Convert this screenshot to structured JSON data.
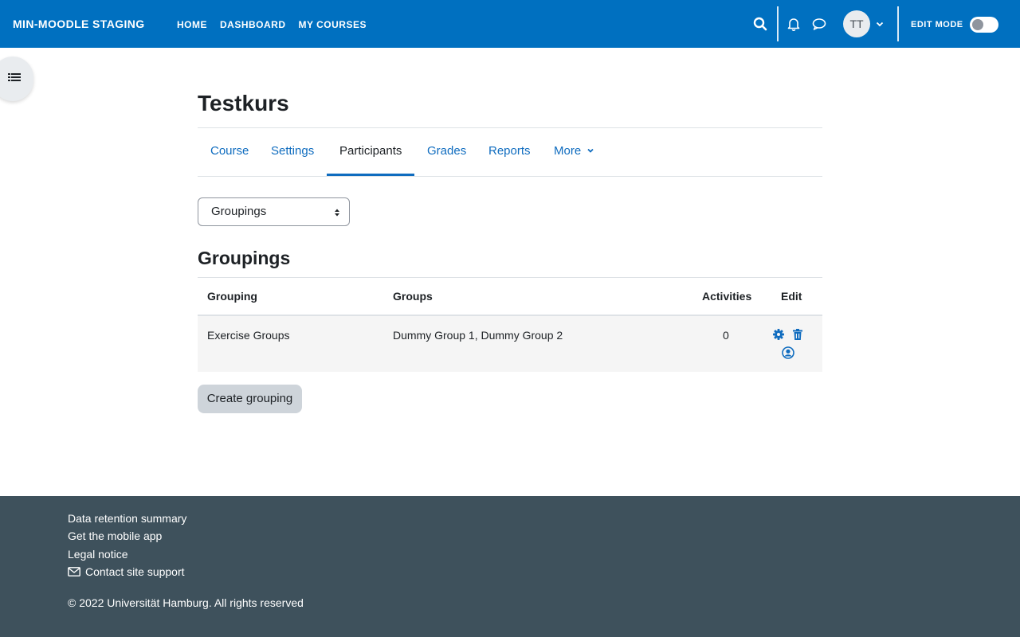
{
  "navbar": {
    "brand": "MIN-MOODLE STAGING",
    "links": [
      "HOME",
      "DASHBOARD",
      "MY COURSES"
    ],
    "avatar_initials": "TT",
    "edit_mode_label": "EDIT MODE"
  },
  "course": {
    "title": "Testkurs",
    "tabs": [
      "Course",
      "Settings",
      "Participants",
      "Grades",
      "Reports",
      "More"
    ],
    "active_tab": "Participants"
  },
  "select": {
    "value": "Groupings"
  },
  "groupings": {
    "title": "Groupings",
    "headers": {
      "grouping": "Grouping",
      "groups": "Groups",
      "activities": "Activities",
      "edit": "Edit"
    },
    "rows": [
      {
        "grouping": "Exercise Groups",
        "groups": "Dummy Group 1, Dummy Group 2",
        "activities": "0"
      }
    ],
    "create_button": "Create grouping"
  },
  "footer": {
    "links": [
      "Data retention summary",
      "Get the mobile app",
      "Legal notice",
      "Contact site support"
    ],
    "copyright": "© 2022 Universität Hamburg. All rights reserved"
  },
  "colors": {
    "navbar": "#0070c0",
    "link": "#0f6cbf",
    "footer": "#3e515c"
  }
}
